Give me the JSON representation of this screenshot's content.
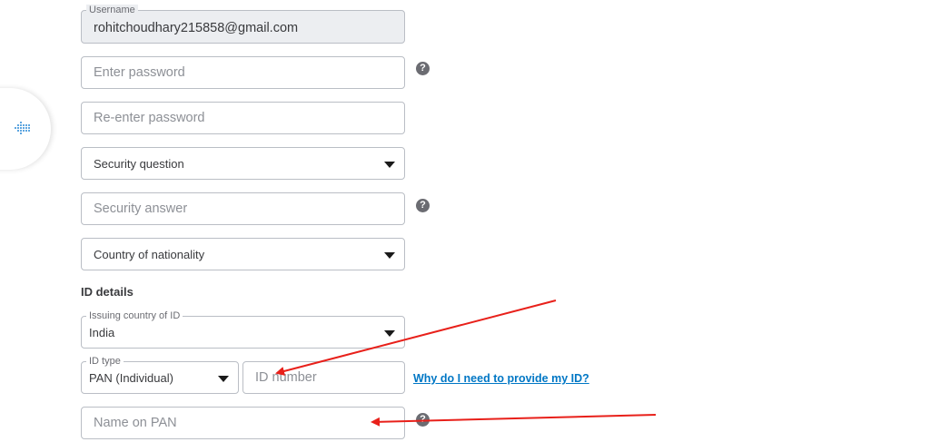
{
  "form": {
    "username": {
      "label": "Username",
      "value": "rohitchoudhary215858@gmail.com"
    },
    "password": {
      "placeholder": "Enter password"
    },
    "reenter_password": {
      "placeholder": "Re-enter password"
    },
    "security_question": {
      "value": "Security question"
    },
    "security_answer": {
      "placeholder": "Security answer"
    },
    "country_of_nationality": {
      "value": "Country of nationality"
    },
    "help_icon_glyph": "?"
  },
  "id_details": {
    "title": "ID details",
    "issuing_country": {
      "label": "Issuing country of ID",
      "value": "India"
    },
    "id_type": {
      "label": "ID type",
      "value": "PAN (Individual)"
    },
    "id_number": {
      "placeholder": "ID number"
    },
    "why_link": "Why do I need to provide my ID?",
    "name_on_pan": {
      "placeholder": "Name on PAN"
    }
  },
  "side_tab": {
    "icon": "dotted-arrow-icon",
    "accent": "#0077c5"
  },
  "annotations": {
    "arrow_color": "#e8201a"
  }
}
